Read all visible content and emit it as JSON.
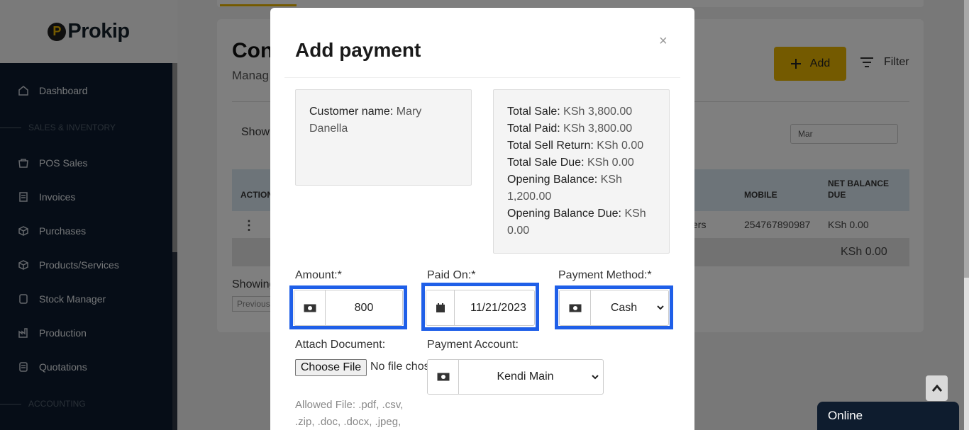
{
  "brand": {
    "logo_letter": "P",
    "name": "Prokip"
  },
  "sidebar": {
    "items": [
      {
        "label": "Dashboard",
        "icon": "home-icon"
      },
      {
        "label": "POS Sales",
        "icon": "basket-icon"
      },
      {
        "label": "Invoices",
        "icon": "invoice-icon"
      },
      {
        "label": "Purchases",
        "icon": "box-icon"
      },
      {
        "label": "Products/Services",
        "icon": "cube-icon"
      },
      {
        "label": "Stock Manager",
        "icon": "stock-icon"
      },
      {
        "label": "Production",
        "icon": "factory-icon"
      },
      {
        "label": "Quotations",
        "icon": "quote-icon"
      }
    ],
    "sections": [
      "SALES & INVENTORY",
      "ACCOUNTING"
    ]
  },
  "page": {
    "title": "Con",
    "subtitle": "Manag",
    "add_label": "Add",
    "filter_label": "Filter",
    "show_label": "Show",
    "search_value": "Mar",
    "table": {
      "headers": {
        "action": "ACTION",
        "mobile": "MOBILE",
        "net_balance_due": "NET BALANCE DUE"
      },
      "row": {
        "group": "ers",
        "mobile": "254767890987",
        "net_balance": "KSh 0.00"
      },
      "total": "KSh 0.00"
    },
    "showing_label": "Showing",
    "previous_label": "Previous"
  },
  "modal": {
    "title": "Add payment",
    "close": "×",
    "customer": {
      "label": "Customer name:",
      "value": "Mary Danella"
    },
    "summary": [
      {
        "label": "Total Sale:",
        "value": "KSh 3,800.00"
      },
      {
        "label": "Total Paid:",
        "value": "KSh 3,800.00"
      },
      {
        "label": "Total Sell Return:",
        "value": "KSh 0.00"
      },
      {
        "label": "Total Sale Due:",
        "value": "KSh 0.00"
      },
      {
        "label": "Opening Balance:",
        "value": "KSh 1,200.00"
      },
      {
        "label": "Opening Balance Due:",
        "value": "KSh 0.00"
      }
    ],
    "amount": {
      "label": "Amount:*",
      "value": "800"
    },
    "paid_on": {
      "label": "Paid On:*",
      "value": "11/21/2023"
    },
    "payment_method": {
      "label": "Payment Method:*",
      "value": "Cash"
    },
    "attach": {
      "label": "Attach Document:",
      "button": "Choose File",
      "status": "No file chosen"
    },
    "payment_account": {
      "label": "Payment Account:",
      "value": "Kendi Main"
    },
    "allowed_files": "Allowed File: .pdf, .csv, .zip, .doc, .docx, .jpeg,"
  },
  "chat": {
    "status": "Online"
  },
  "colors": {
    "accent": "#e8b400",
    "sidebar": "#0d1b2e",
    "highlight": "#1f5fe8"
  }
}
